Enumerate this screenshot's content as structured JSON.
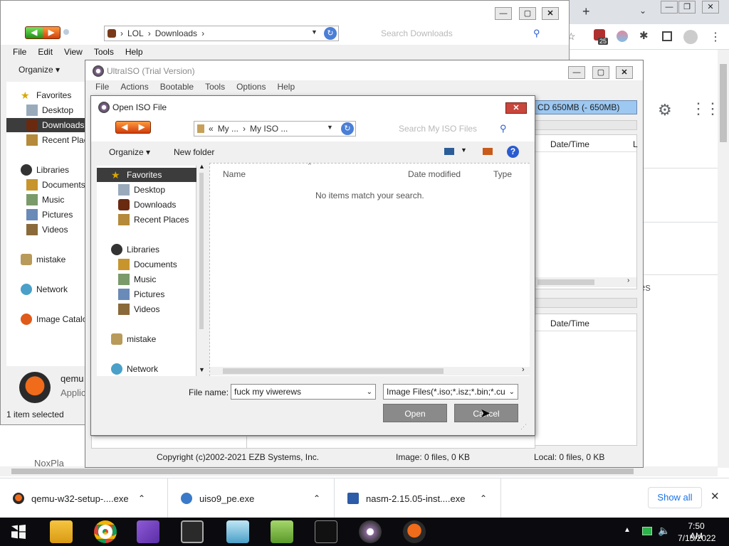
{
  "explorer": {
    "address": {
      "part1": "LOL",
      "part2": "Downloads"
    },
    "search_placeholder": "Search Downloads",
    "menu": [
      "File",
      "Edit",
      "View",
      "Tools",
      "Help"
    ],
    "organize": "Organize",
    "nav": {
      "favorites": "Favorites",
      "desktop": "Desktop",
      "downloads": "Downloads",
      "recent": "Recent Plac",
      "libraries": "Libraries",
      "documents": "Documents",
      "music": "Music",
      "pictures": "Pictures",
      "videos": "Videos",
      "mistake": "mistake",
      "network": "Network",
      "image_catalog": "Image Catalo"
    },
    "preview": {
      "name": "qemu",
      "type": "Applic"
    },
    "status": "1 item selected"
  },
  "chrome": {
    "notification_badge": "25",
    "partial_text_1": "es",
    "partial_text_2": "NoxPla"
  },
  "ultraiso": {
    "title": "UltraISO (Trial Version)",
    "menu": [
      "File",
      "Actions",
      "Bootable",
      "Tools",
      "Options",
      "Help"
    ],
    "size_selector": "CD 650MB (- 650MB)",
    "col_datetime_top": "Date/Time",
    "col_l": "L",
    "col_datetime_bottom": "Date/Time",
    "status": {
      "copyright": "Copyright (c)2002-2021 EZB Systems, Inc.",
      "image": "Image: 0 files, 0 KB",
      "local": "Local: 0 files, 0 KB"
    }
  },
  "dialog": {
    "title": "Open ISO File",
    "address": {
      "prefix": "«",
      "part1": "My ...",
      "part2": "My ISO ..."
    },
    "search_placeholder": "Search My ISO Files",
    "organize": "Organize",
    "new_folder": "New folder",
    "nav": {
      "favorites": "Favorites",
      "desktop": "Desktop",
      "downloads": "Downloads",
      "recent": "Recent Places",
      "libraries": "Libraries",
      "documents": "Documents",
      "music": "Music",
      "pictures": "Pictures",
      "videos": "Videos",
      "mistake": "mistake",
      "network": "Network"
    },
    "columns": {
      "name": "Name",
      "date": "Date modified",
      "type": "Type"
    },
    "empty_message": "No items match your search.",
    "file_name_label": "File name:",
    "file_name_value": "fuck my  viwerews",
    "filter_value": "Image Files(*.iso;*.isz;*.bin;*.cue",
    "open_label": "Open",
    "cancel_label": "Cancel"
  },
  "downloads": {
    "items": [
      "qemu-w32-setup-....exe",
      "uiso9_pe.exe",
      "nasm-2.15.05-inst....exe"
    ],
    "show_all": "Show all"
  },
  "taskbar": {
    "time": "7:50 AM",
    "date": "7/15/2022"
  },
  "colors": {
    "selection": "#3c3c3c",
    "ultraiso_highlight": "#9cc8f2",
    "close_red": "#c9463d",
    "taskbar": "#0b0b0f"
  }
}
